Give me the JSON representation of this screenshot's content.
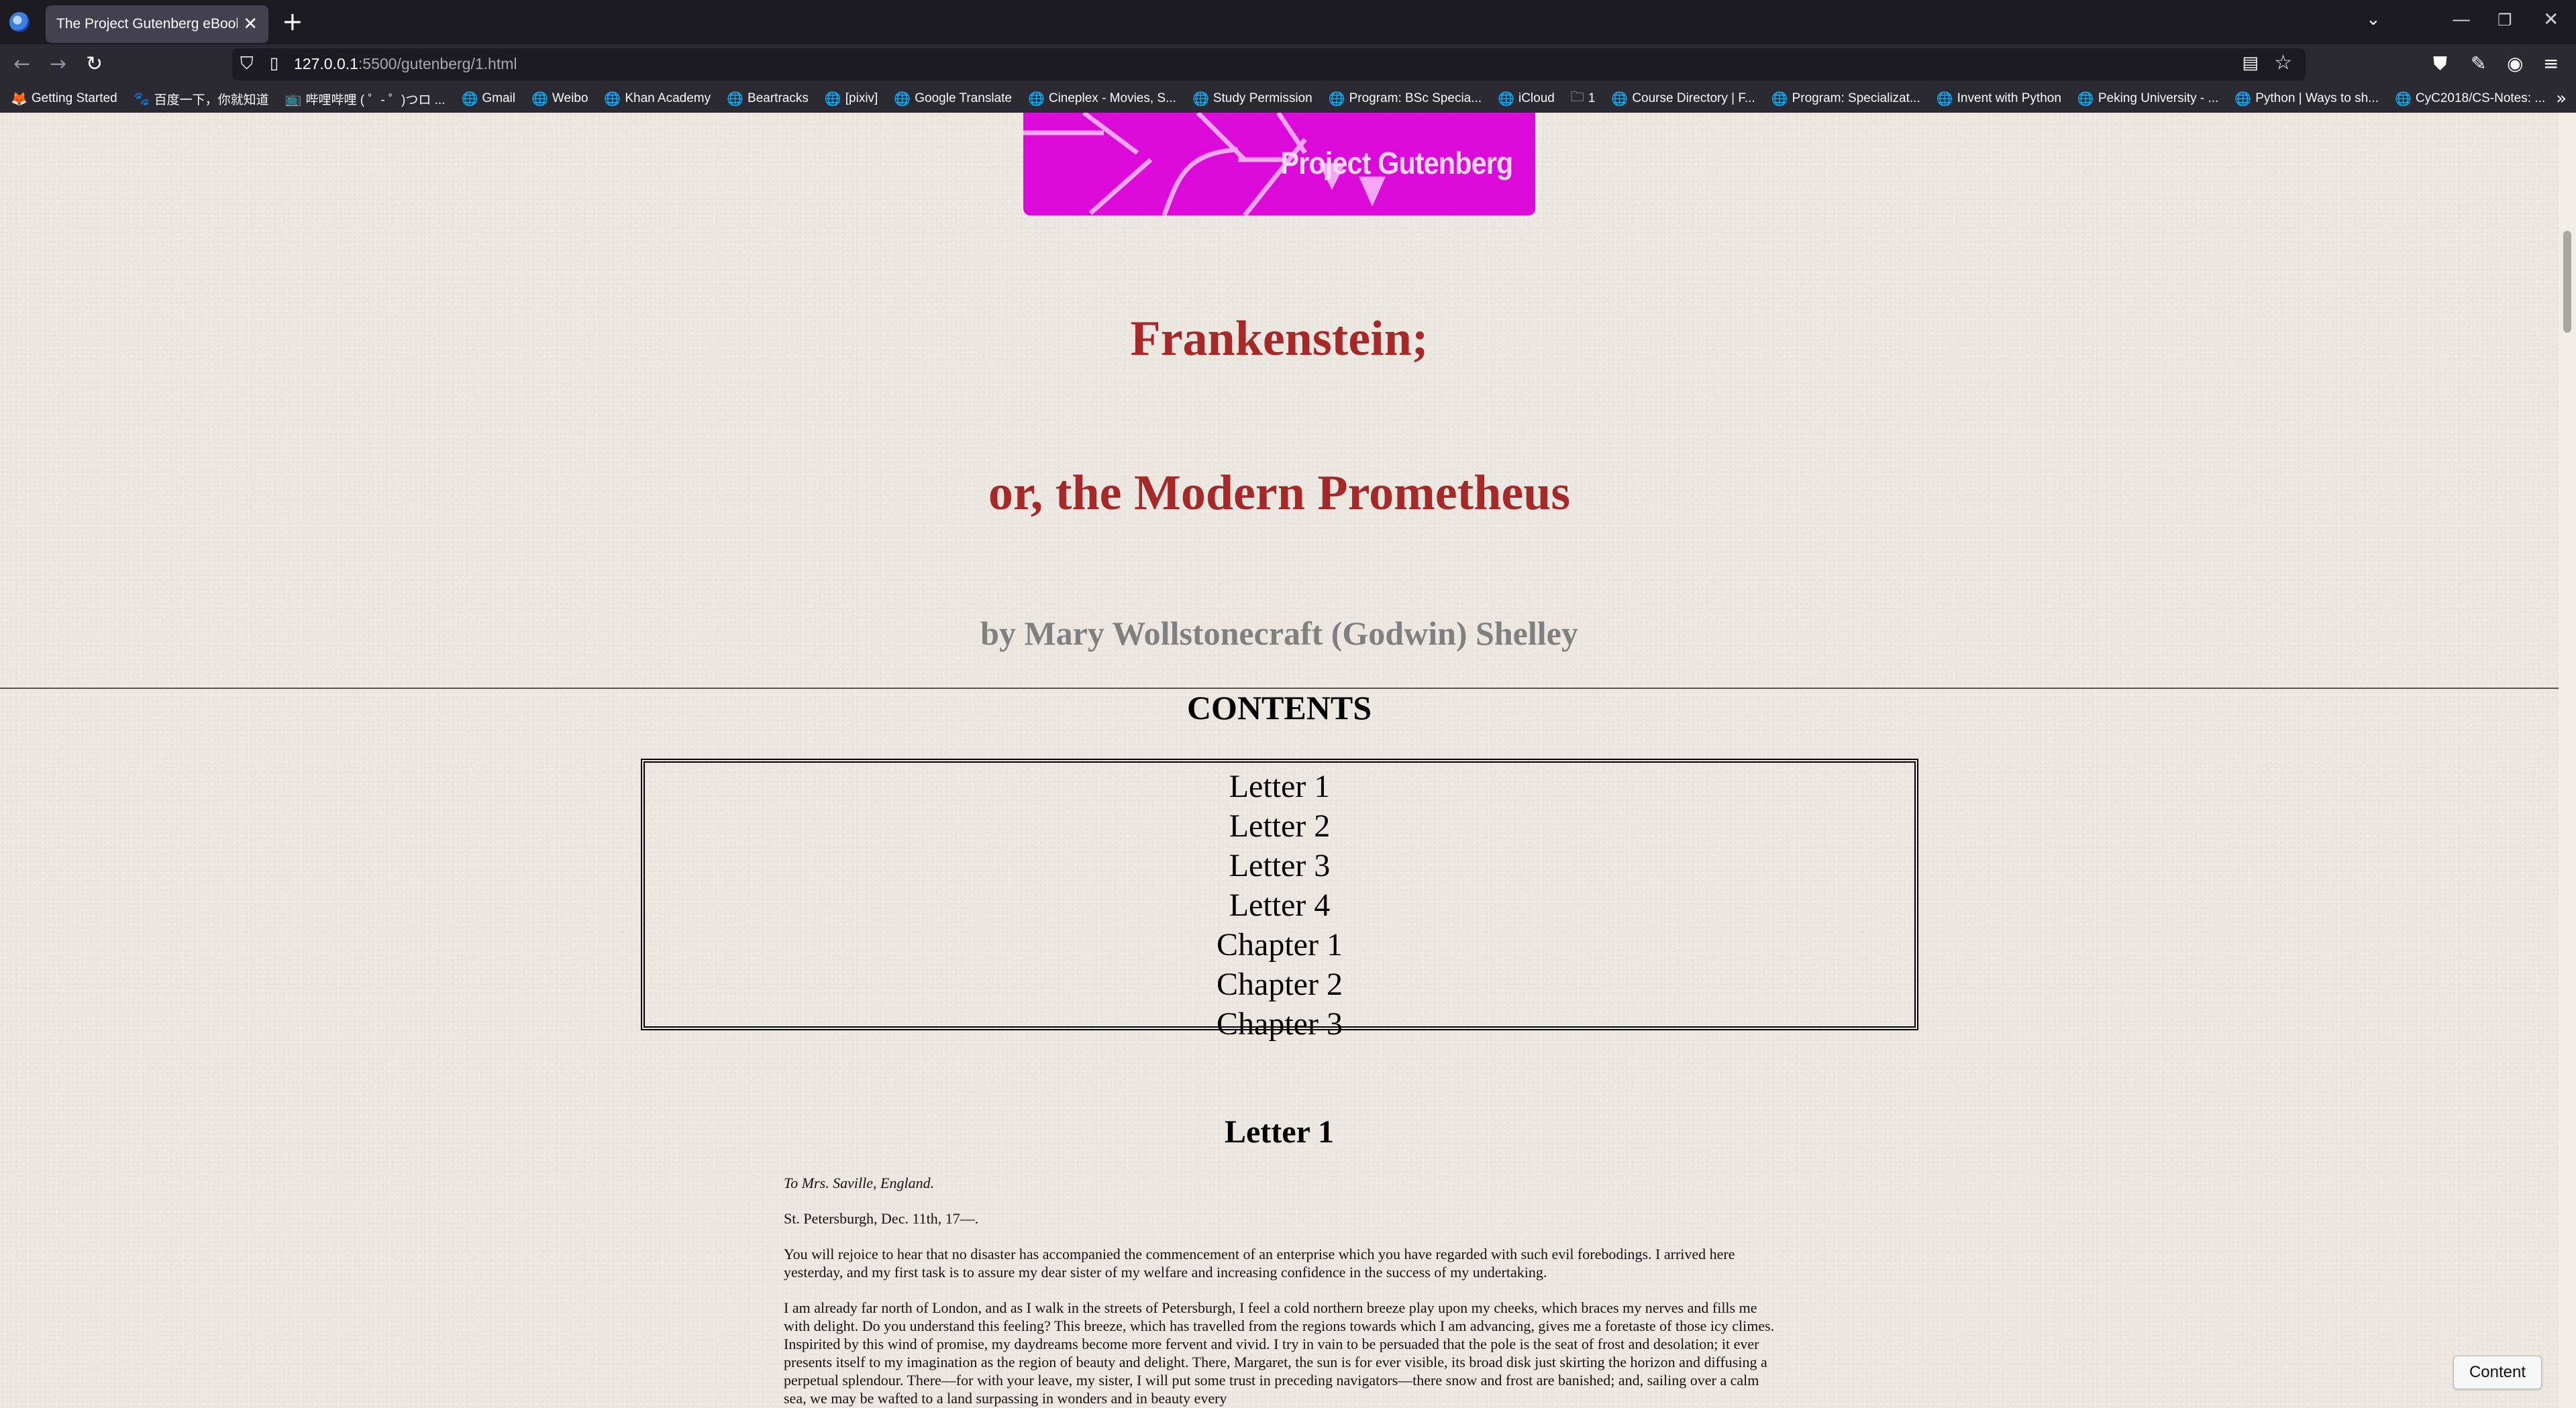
{
  "browser": {
    "tab_title": "The Project Gutenberg eBook of",
    "tab_close": "✕",
    "new_tab": "+",
    "tab_list": "⌄",
    "window_controls": {
      "minimize": "—",
      "restore": "❐",
      "close": "✕"
    },
    "nav": {
      "back": "←",
      "forward": "→",
      "reload": "↻"
    },
    "url_host": "127.0.0.1",
    "url_rest": ":5500/gutenberg/1.html",
    "icons": {
      "shield": "shield-icon",
      "page": "page-icon",
      "reader": "reader-view-icon",
      "star": "bookmark-star-icon",
      "pocket": "pocket-icon",
      "wrench": "wrench-icon",
      "account": "account-icon",
      "menu": "hamburger-menu-icon"
    }
  },
  "bookmarks": [
    {
      "label": "Getting Started",
      "icon": "🦊"
    },
    {
      "label": "百度一下，你就知道",
      "icon": "🐾"
    },
    {
      "label": "哔哩哔哩 ( ゜- ゜)つロ ...",
      "icon": "📺"
    },
    {
      "label": "Gmail",
      "icon": "🌐"
    },
    {
      "label": "Weibo",
      "icon": "🌐"
    },
    {
      "label": "Khan Academy",
      "icon": "🌐"
    },
    {
      "label": "Beartracks",
      "icon": "🌐"
    },
    {
      "label": "[pixiv]",
      "icon": "🌐"
    },
    {
      "label": "Google Translate",
      "icon": "🌐"
    },
    {
      "label": "Cineplex - Movies, S...",
      "icon": "🌐"
    },
    {
      "label": "Study Permission",
      "icon": "🌐"
    },
    {
      "label": "Program: BSc Specia...",
      "icon": "🌐"
    },
    {
      "label": "iCloud",
      "icon": "🌐"
    },
    {
      "label": "1",
      "icon": "🗀"
    },
    {
      "label": "Course Directory | F...",
      "icon": "🌐"
    },
    {
      "label": "Program: Specializat...",
      "icon": "🌐"
    },
    {
      "label": "Invent with Python",
      "icon": "🌐"
    },
    {
      "label": "Peking University - ...",
      "icon": "🌐"
    },
    {
      "label": "Python | Ways to sh...",
      "icon": "🌐"
    },
    {
      "label": "CyC2018/CS-Notes: ...",
      "icon": "🌐"
    }
  ],
  "bookmarks_overflow": "»",
  "page": {
    "logo_text": "Project Gutenberg",
    "title": "Frankenstein;",
    "subtitle": "or, the Modern Prometheus",
    "author": "by Mary Wollstonecraft (Godwin) Shelley",
    "contents_heading": "CONTENTS",
    "toc": [
      "Letter 1",
      "Letter 2",
      "Letter 3",
      "Letter 4",
      "Chapter 1",
      "Chapter 2",
      "Chapter 3"
    ],
    "letter_heading": "Letter 1",
    "salutation": "To Mrs. Saville, England.",
    "dateline": "St. Petersburgh, Dec. 11th, 17—.",
    "paragraph_1": "You will rejoice to hear that no disaster has accompanied the commencement of an enterprise which you have regarded with such evil forebodings. I arrived here yesterday, and my first task is to assure my dear sister of my welfare and increasing confidence in the success of my undertaking.",
    "paragraph_2": "I am already far north of London, and as I walk in the streets of Petersburgh, I feel a cold northern breeze play upon my cheeks, which braces my nerves and fills me with delight. Do you understand this feeling? This breeze, which has travelled from the regions towards which I am advancing, gives me a foretaste of those icy climes. Inspirited by this wind of promise, my daydreams become more fervent and vivid. I try in vain to be persuaded that the pole is the seat of frost and desolation; it ever presents itself to my imagination as the region of beauty and delight. There, Margaret, the sun is for ever visible, its broad disk just skirting the horizon and diffusing a perpetual splendour. There—for with your leave, my sister, I will put some trust in preceding navigators—there snow and frost are banished; and, sailing over a calm sea, we may be wafted to a land surpassing in wonders and in beauty every",
    "content_button": "Content"
  }
}
